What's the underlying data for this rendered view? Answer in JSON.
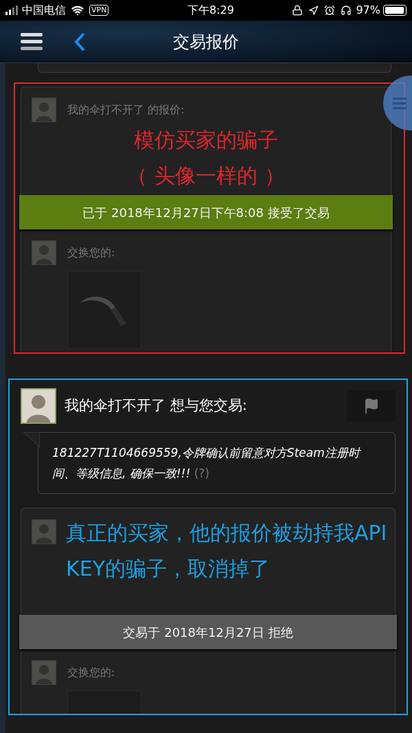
{
  "status_bar": {
    "carrier": "中国电信",
    "vpn": "VPN",
    "time": "下午8:29",
    "battery": "97%"
  },
  "nav": {
    "title": "交易报价"
  },
  "offers": [
    {
      "color": "#e0252a",
      "title": "我的伞打不开了 的报价:",
      "note": [
        "模仿买家的骗子",
        "（ 头像一样的 ）"
      ],
      "status": {
        "kind": "accepted",
        "text": "已于 2018年12月27日下午8:08 接受了交易"
      },
      "trade_label": "交换您的:",
      "items": [
        {
          "kind": "knife"
        }
      ]
    },
    {
      "color": "#1d9fe2",
      "sender_line": "我的伞打不开了 想与您交易:",
      "message": "181227T1104669559,令牌确认前留意对方Steam注册时间、等级信息, 确保一致!!!",
      "help": "(?)",
      "note": [
        "真正的买家，他的报价被劫持我API",
        "KEY的骗子，取消掉了"
      ],
      "status": {
        "kind": "declined",
        "text": "交易于 2018年12月27日 拒绝"
      },
      "trade_label": "交换您的:",
      "items": [
        {
          "kind": "empty"
        }
      ]
    }
  ]
}
